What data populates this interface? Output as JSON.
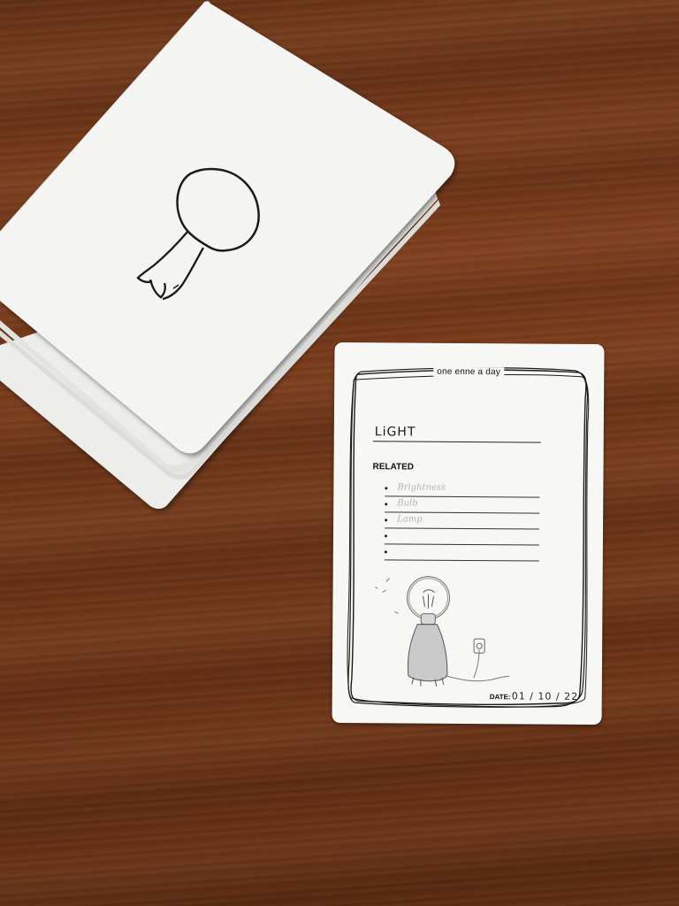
{
  "scene": {
    "table_color": "#6f3618",
    "card_color": "#f7f7f6"
  },
  "card_stack": {
    "icon": "character-round-head-icon"
  },
  "journal_card": {
    "brand": "one enne a day",
    "word": "LiGHT",
    "related_label": "RELATED",
    "related": [
      "Brightness",
      "Bulb",
      "Lamp",
      "",
      ""
    ],
    "date_label": "DATE:",
    "date_value": "01 / 10 / 22",
    "sketch_icon": "character-lightbulb-sketch-icon"
  }
}
